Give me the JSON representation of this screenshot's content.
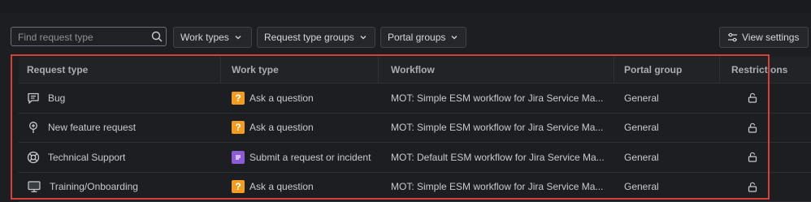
{
  "toolbar": {
    "search_placeholder": "Find request type",
    "work_types_label": "Work types",
    "request_type_groups_label": "Request type groups",
    "portal_groups_label": "Portal groups",
    "view_settings_label": "View settings"
  },
  "table": {
    "columns": [
      "Request type",
      "Work type",
      "Workflow",
      "Portal group",
      "Restrictions"
    ],
    "rows": [
      {
        "request_type": "Bug",
        "icon": "chat-bubble-icon",
        "work_type": "Ask a question",
        "work_type_icon": "question-icon",
        "work_type_color": "#f29d1f",
        "workflow": "MOT: Simple ESM workflow for Jira Service Ma...",
        "portal_group": "General"
      },
      {
        "request_type": "New feature request",
        "icon": "lightbulb-icon",
        "work_type": "Ask a question",
        "work_type_icon": "question-icon",
        "work_type_color": "#f29d1f",
        "workflow": "MOT: Simple ESM workflow for Jira Service Ma...",
        "portal_group": "General"
      },
      {
        "request_type": "Technical Support",
        "icon": "lifebuoy-icon",
        "work_type": "Submit a request or incident",
        "work_type_icon": "list-icon",
        "work_type_color": "#8d5bd6",
        "workflow": "MOT: Default ESM workflow for Jira Service Ma...",
        "portal_group": "General"
      },
      {
        "request_type": "Training/Onboarding",
        "icon": "monitor-icon",
        "work_type": "Ask a question",
        "work_type_icon": "question-icon",
        "work_type_color": "#f29d1f",
        "workflow": "MOT: Simple ESM workflow for Jira Service Ma...",
        "portal_group": "General"
      }
    ]
  },
  "colors": {
    "background": "#1d1e21",
    "highlight_border": "#d6403b",
    "question_icon": "#f29d1f",
    "request_icon": "#8d5bd6"
  }
}
